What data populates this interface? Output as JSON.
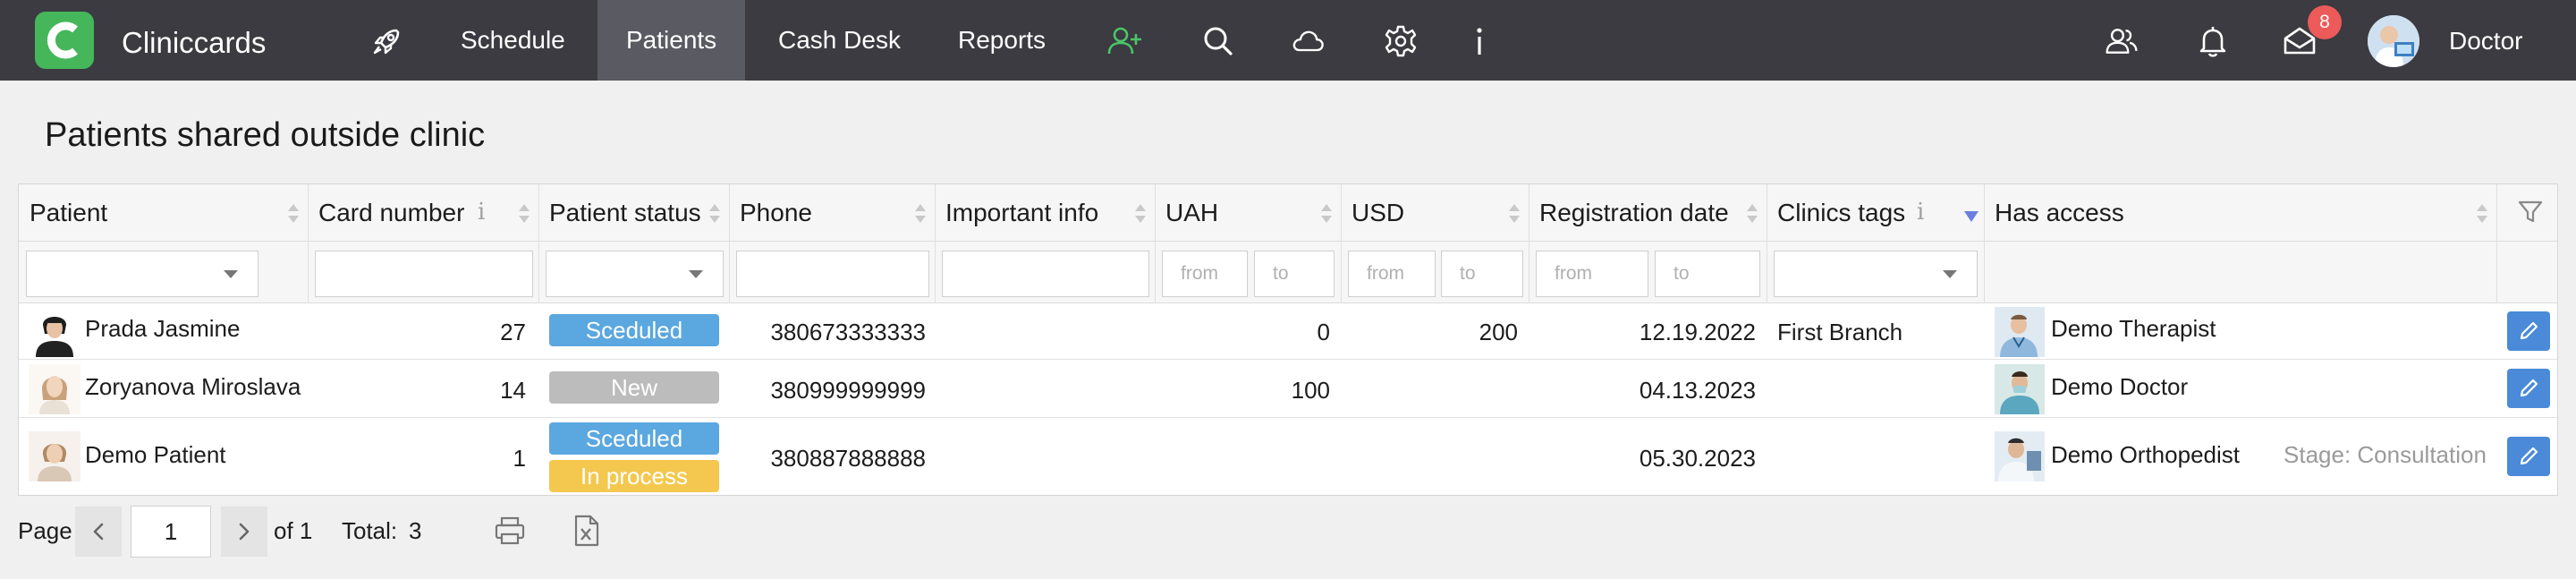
{
  "app": {
    "title": "Cliniccards",
    "user_name": "Doctor",
    "notification_count": "8"
  },
  "nav": {
    "items": [
      {
        "label": "Schedule"
      },
      {
        "label": "Patients"
      },
      {
        "label": "Cash Desk"
      },
      {
        "label": "Reports"
      }
    ],
    "icons": [
      "rocket-icon",
      "add-user-icon",
      "search-icon",
      "cloud-icon",
      "gear-icon",
      "info-icon",
      "users-icon",
      "bell-icon",
      "mail-icon"
    ]
  },
  "page": {
    "title": "Patients shared outside clinic"
  },
  "table": {
    "columns": [
      {
        "label": "Patient"
      },
      {
        "label": "Card number"
      },
      {
        "label": "Patient status"
      },
      {
        "label": "Phone"
      },
      {
        "label": "Important info"
      },
      {
        "label": "UAH"
      },
      {
        "label": "USD"
      },
      {
        "label": "Registration date"
      },
      {
        "label": "Clinics tags"
      },
      {
        "label": "Has access"
      }
    ],
    "filters": {
      "from_placeholder": "from",
      "to_placeholder": "to"
    },
    "rows": [
      {
        "patient": "Prada Jasmine",
        "card": "27",
        "statuses": [
          "Sceduled"
        ],
        "phone": "380673333333",
        "info": "",
        "uah": "0",
        "usd": "200",
        "reg_date": "12.19.2022",
        "tags": "First Branch",
        "access": "Demo Therapist",
        "stage": ""
      },
      {
        "patient": "Zoryanova Miroslava",
        "card": "14",
        "statuses": [
          "New"
        ],
        "phone": "380999999999",
        "info": "",
        "uah": "100",
        "usd": "",
        "reg_date": "04.13.2023",
        "tags": "",
        "access": "Demo Doctor",
        "stage": ""
      },
      {
        "patient": "Demo Patient",
        "card": "1",
        "statuses": [
          "Sceduled",
          "In process"
        ],
        "phone": "380887888888",
        "info": "",
        "uah": "",
        "usd": "",
        "reg_date": "05.30.2023",
        "tags": "",
        "access": "Demo Orthopedist",
        "stage": "Stage: Consultation"
      }
    ],
    "status_colors": {
      "Sceduled": "#5ba7df",
      "New": "#bcbcbc",
      "In process": "#f4c84e"
    }
  },
  "footer": {
    "page_label": "Page",
    "page_value": "1",
    "of_label": "of 1",
    "total_label": "Total:",
    "total_value": "3"
  },
  "colors": {
    "navbar": "#3b3b41",
    "brand": "#46b65a",
    "accent": "#4a8ad8"
  }
}
